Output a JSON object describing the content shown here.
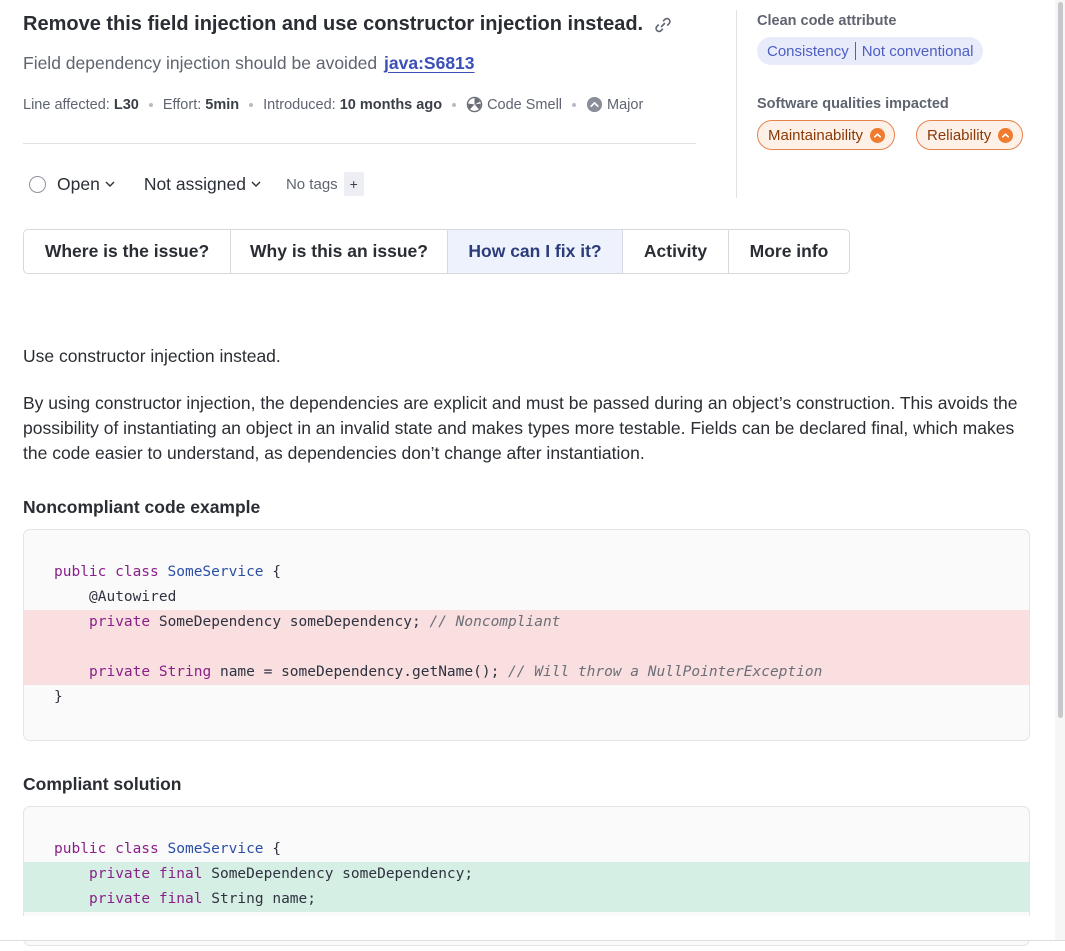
{
  "header": {
    "title": "Remove this field injection and use constructor injection instead.",
    "subtitle": "Field dependency injection should be avoided",
    "rule_key": "java:S6813"
  },
  "meta": {
    "line_label": "Line affected:",
    "line_value": "L30",
    "effort_label": "Effort:",
    "effort_value": "5min",
    "introduced_label": "Introduced:",
    "introduced_value": "10 months ago",
    "type": "Code Smell",
    "severity": "Major"
  },
  "side": {
    "clean_code_label": "Clean code attribute",
    "attribute": "Consistency",
    "attribute_detail": "Not conventional",
    "qualities_label": "Software qualities impacted",
    "qualities": [
      "Maintainability",
      "Reliability"
    ]
  },
  "status": {
    "state": "Open",
    "assignee": "Not assigned",
    "tags": "No tags",
    "tag_add": "+"
  },
  "tabs": [
    {
      "label": "Where is the issue?",
      "active": false
    },
    {
      "label": "Why is this an issue?",
      "active": false
    },
    {
      "label": "How can I fix it?",
      "active": true
    },
    {
      "label": "Activity",
      "active": false
    },
    {
      "label": "More info",
      "active": false
    }
  ],
  "content": {
    "intro": "Use constructor injection instead.",
    "paragraph": "By using constructor injection, the dependencies are explicit and must be passed during an object’s construction. This avoids the possibility of instantiating an object in an invalid state and makes types more testable. Fields can be declared final, which makes the code easier to understand, as dependencies don’t change after instantiation.",
    "noncompliant_heading": "Noncompliant code example",
    "compliant_heading": "Compliant solution"
  },
  "noncompliant_code": {
    "l1_kw": "public class",
    "l1_type": "SomeService",
    "l1_rest": " {",
    "l2": "@Autowired",
    "l3_kw": "private",
    "l3_rest": " SomeDependency someDependency; ",
    "l3_comment": "// Noncompliant",
    "l5_kw": "private",
    "l5_type": "String",
    "l5_rest": " name = someDependency.getName(); ",
    "l5_comment": "// Will throw a NullPointerException",
    "l6": "}"
  },
  "compliant_code": {
    "l1_kw": "public class",
    "l1_type": "SomeService",
    "l1_rest": " {",
    "l2_kw": "private final",
    "l2_rest": " SomeDependency someDependency;",
    "l3_kw": "private final",
    "l3_rest": " String name;"
  },
  "colors": {
    "accent": "#4d5ec4",
    "quality_orange": "#f07b2e",
    "removed_line": "#f9dfdf",
    "added_line": "#d6efe4"
  }
}
